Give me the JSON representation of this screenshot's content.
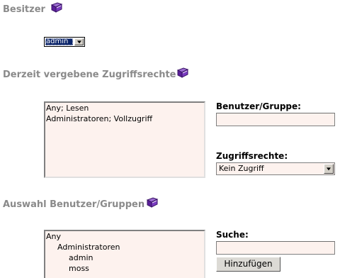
{
  "owner": {
    "title": "Besitzer",
    "help_icon": "help-book-icon",
    "selected": "admin"
  },
  "current_rights": {
    "title": "Derzeit vergebene Zugriffsrechte",
    "help_icon": "help-book-icon",
    "entries": [
      "Any; Lesen",
      "Administratoren; Vollzugriff"
    ],
    "user_group_label": "Benutzer/Gruppe:",
    "user_group_value": "",
    "rights_label": "Zugriffsrechte:",
    "rights_selected": "Kein Zugriff"
  },
  "selection": {
    "title": "Auswahl Benutzer/Gruppen",
    "help_icon": "help-book-icon",
    "tree": [
      {
        "label": "Any",
        "level": 0
      },
      {
        "label": "Administratoren",
        "level": 1
      },
      {
        "label": "admin",
        "level": 2
      },
      {
        "label": "moss",
        "level": 2
      }
    ],
    "search_label": "Suche:",
    "search_value": "",
    "add_button": "Hinzufügen"
  },
  "colors": {
    "title_gray": "#8a8a8a",
    "field_bg": "#fdf2ee",
    "selection_blue": "#0a246a",
    "help_icon_purple": "#6a2aa8"
  }
}
